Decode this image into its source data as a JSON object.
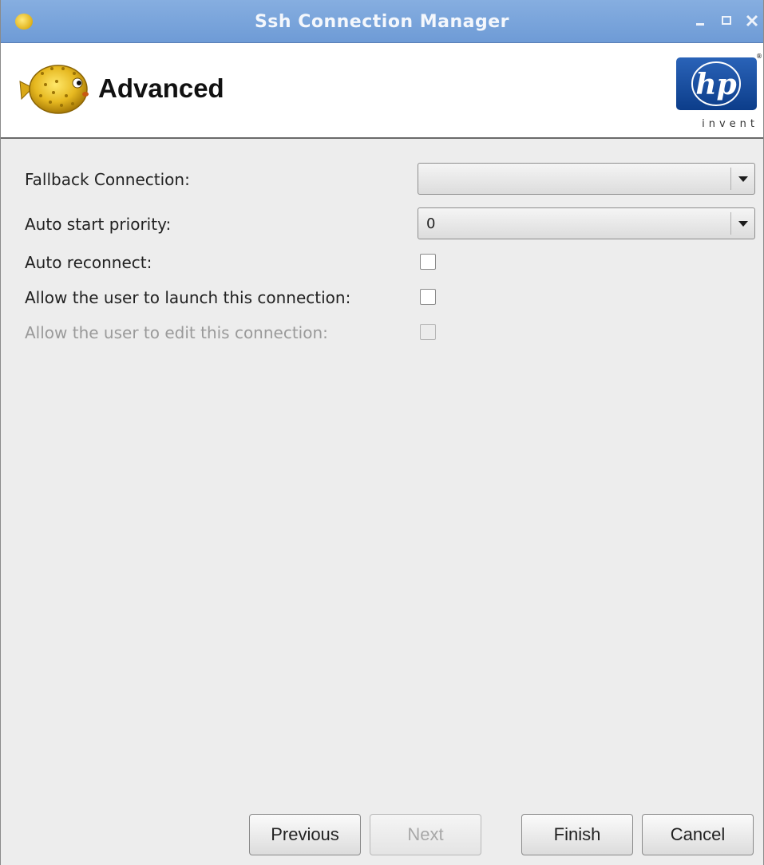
{
  "window": {
    "title": "Ssh Connection Manager",
    "controls": {
      "minimize": "_",
      "maximize": "□",
      "close": "×"
    },
    "colors": {
      "titlebar": "#7aa4dc",
      "background": "#ededed"
    }
  },
  "header": {
    "title": "Advanced",
    "icon": "pufferfish-icon",
    "logo": {
      "name": "hp-logo",
      "mark": "hp",
      "tagline": "invent",
      "color": "#1a4e9f"
    }
  },
  "form": {
    "fallback_connection": {
      "label": "Fallback Connection:",
      "value": ""
    },
    "auto_start_priority": {
      "label": "Auto start priority:",
      "value": "0"
    },
    "auto_reconnect": {
      "label": "Auto reconnect:",
      "checked": false
    },
    "allow_launch": {
      "label": "Allow the user to launch this connection:",
      "checked": false
    },
    "allow_edit": {
      "label": "Allow the user to edit this connection:",
      "checked": false,
      "disabled": true
    }
  },
  "buttons": {
    "previous": "Previous",
    "next": "Next",
    "finish": "Finish",
    "cancel": "Cancel"
  }
}
